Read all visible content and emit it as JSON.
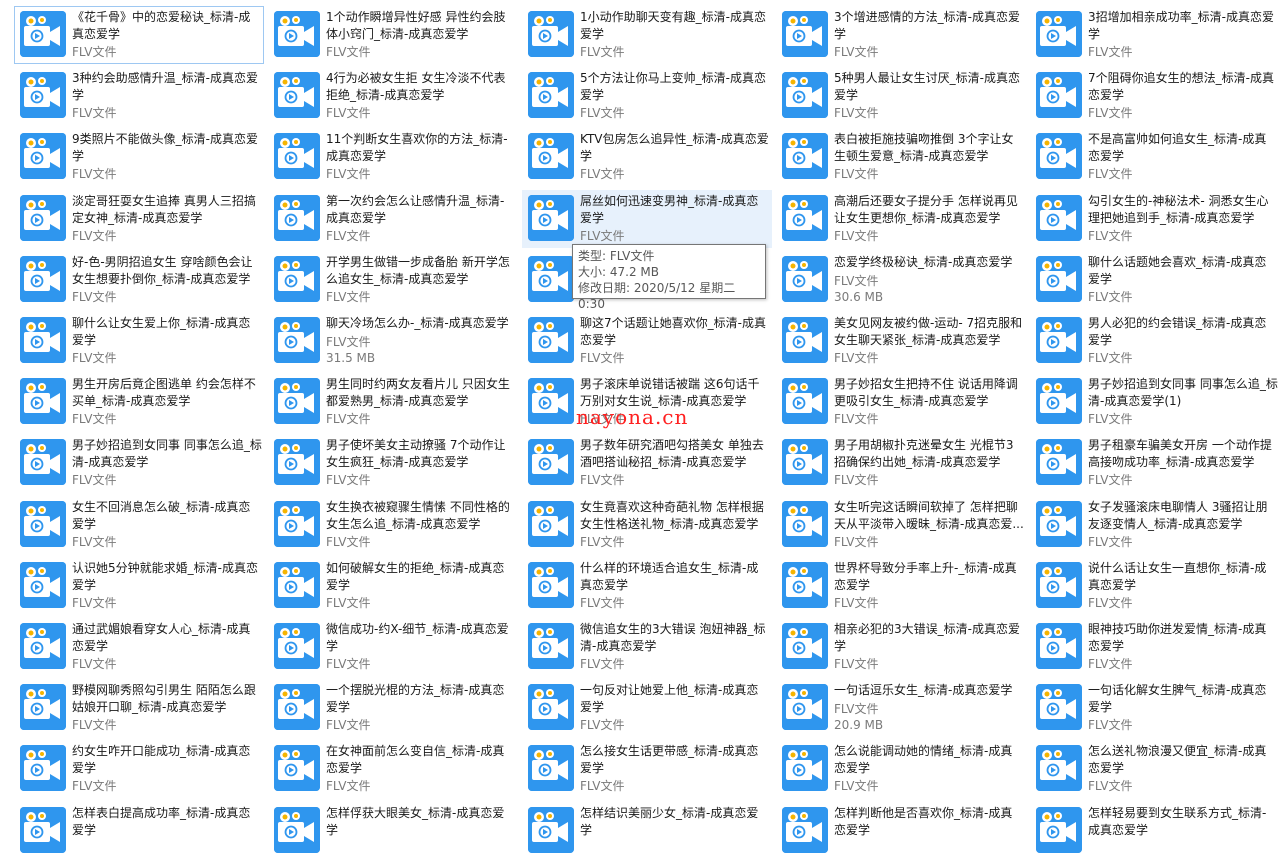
{
  "file_type_label": "FLV文件",
  "icon_name": "video-file-icon",
  "files": [
    {
      "name": "《花千骨》中的恋爱秘诀_标清-成真恋爱学",
      "sub": "FLV文件"
    },
    {
      "name": "1个动作瞬增异性好感 异性约会肢体小窍门_标清-成真恋爱学",
      "sub": "FLV文件"
    },
    {
      "name": "1小动作助聊天变有趣_标清-成真恋爱学",
      "sub": "FLV文件"
    },
    {
      "name": "3个增进感情的方法_标清-成真恋爱学",
      "sub": "FLV文件"
    },
    {
      "name": "3招增加相亲成功率_标清-成真恋爱学",
      "sub": "FLV文件"
    },
    {
      "name": "3种约会助感情升温_标清-成真恋爱学",
      "sub": "FLV文件"
    },
    {
      "name": "4行为必被女生拒 女生冷淡不代表拒绝_标清-成真恋爱学",
      "sub": "FLV文件"
    },
    {
      "name": "5个方法让你马上变帅_标清-成真恋爱学",
      "sub": "FLV文件"
    },
    {
      "name": "5种男人最让女生讨厌_标清-成真恋爱学",
      "sub": "FLV文件"
    },
    {
      "name": "7个阻碍你追女生的想法_标清-成真恋爱学",
      "sub": "FLV文件"
    },
    {
      "name": "9类照片不能做头像_标清-成真恋爱学",
      "sub": "FLV文件"
    },
    {
      "name": "11个判断女生喜欢你的方法_标清-成真恋爱学",
      "sub": "FLV文件"
    },
    {
      "name": "KTV包房怎么追异性_标清-成真恋爱学",
      "sub": "FLV文件"
    },
    {
      "name": "表白被拒施技骗吻推倒 3个字让女生顿生爱意_标清-成真恋爱学",
      "sub": "FLV文件"
    },
    {
      "name": "不是高富帅如何追女生_标清-成真恋爱学",
      "sub": "FLV文件"
    },
    {
      "name": "淡定哥狂耍女生追捧 真男人三招搞定女神_标清-成真恋爱学",
      "sub": "FLV文件"
    },
    {
      "name": "第一次约会怎么让感情升温_标清-成真恋爱学",
      "sub": "FLV文件"
    },
    {
      "name": "屌丝如何迅速变男神_标清-成真恋爱学",
      "sub": "FLV文件"
    },
    {
      "name": "高潮后还要女子提分手 怎样说再见让女生更想你_标清-成真恋爱学",
      "sub": "FLV文件"
    },
    {
      "name": "勾引女生的-神秘法术- 洞悉女生心理把她追到手_标清-成真恋爱学",
      "sub": "FLV文件"
    },
    {
      "name": "好-色-男阴招追女生 穿啥颜色会让女生想要扑倒你_标清-成真恋爱学",
      "sub": "FLV文件"
    },
    {
      "name": "开学男生做错一步成备胎 新开学怎么追女生_标清-成真恋爱学",
      "sub": "FLV文件"
    },
    {
      "name": "",
      "sub": ""
    },
    {
      "name": "恋爱学终极秘诀_标清-成真恋爱学",
      "sub": "FLV文件",
      "size": "30.6 MB"
    },
    {
      "name": "聊什么话题她会喜欢_标清-成真恋爱学",
      "sub": "FLV文件"
    },
    {
      "name": "聊什么让女生爱上你_标清-成真恋爱学",
      "sub": "FLV文件"
    },
    {
      "name": "聊天冷场怎么办-_标清-成真恋爱学",
      "sub": "FLV文件",
      "size": "31.5 MB"
    },
    {
      "name": "聊这7个话题让她喜欢你_标清-成真恋爱学",
      "sub": "FLV文件"
    },
    {
      "name": "美女见网友被约做-运动- 7招克服和女生聊天紧张_标清-成真恋爱学",
      "sub": "FLV文件"
    },
    {
      "name": "男人必犯的约会错误_标清-成真恋爱学",
      "sub": "FLV文件"
    },
    {
      "name": "男生开房后竟企图逃单 约会怎样不买单_标清-成真恋爱学",
      "sub": "FLV文件"
    },
    {
      "name": "男生同时约两女友看片儿 只因女生都爱熟男_标清-成真恋爱学",
      "sub": "FLV文件"
    },
    {
      "name": "男子滚床单说错话被踹 这6句话千万别对女生说_标清-成真恋爱学",
      "sub": "FLV文件"
    },
    {
      "name": "男子妙招女生把持不住 说话用降调更吸引女生_标清-成真恋爱学",
      "sub": "FLV文件"
    },
    {
      "name": "男子妙招追到女同事 同事怎么追_标清-成真恋爱学(1)",
      "sub": "FLV文件"
    },
    {
      "name": "男子妙招追到女同事 同事怎么追_标清-成真恋爱学",
      "sub": "FLV文件"
    },
    {
      "name": "男子使坏美女主动撩骚 7个动作让女生疯狂_标清-成真恋爱学",
      "sub": "FLV文件"
    },
    {
      "name": "男子数年研究酒吧勾搭美女 单独去酒吧搭讪秘招_标清-成真恋爱学",
      "sub": "FLV文件"
    },
    {
      "name": "男子用胡椒扑克迷晕女生 光棍节3招确保约出她_标清-成真恋爱学",
      "sub": "FLV文件"
    },
    {
      "name": "男子租豪车骗美女开房 一个动作提高接吻成功率_标清-成真恋爱学",
      "sub": "FLV文件"
    },
    {
      "name": "女生不回消息怎么破_标清-成真恋爱学",
      "sub": "FLV文件"
    },
    {
      "name": "女生换衣被窥骤生情愫 不同性格的女生怎么追_标清-成真恋爱学",
      "sub": "FLV文件"
    },
    {
      "name": "女生竟喜欢这种奇葩礼物 怎样根据女生性格送礼物_标清-成真恋爱学",
      "sub": "FLV文件"
    },
    {
      "name": "女生听完这话瞬间软掉了 怎样把聊天从平淡带入暧昧_标清-成真恋爱...",
      "sub": "FLV文件"
    },
    {
      "name": "女子发骚滚床电聊情人 3骚招让朋友逐变情人_标清-成真恋爱学",
      "sub": "FLV文件"
    },
    {
      "name": "认识她5分钟就能求婚_标清-成真恋爱学",
      "sub": "FLV文件"
    },
    {
      "name": "如何破解女生的拒绝_标清-成真恋爱学",
      "sub": "FLV文件"
    },
    {
      "name": "什么样的环境适合追女生_标清-成真恋爱学",
      "sub": "FLV文件"
    },
    {
      "name": "世界杯导致分手率上升-_标清-成真恋爱学",
      "sub": "FLV文件"
    },
    {
      "name": "说什么话让女生一直想你_标清-成真恋爱学",
      "sub": "FLV文件"
    },
    {
      "name": "通过武媚娘看穿女人心_标清-成真恋爱学",
      "sub": "FLV文件"
    },
    {
      "name": "微信成功-约X-细节_标清-成真恋爱学",
      "sub": "FLV文件"
    },
    {
      "name": "微信追女生的3大错误 泡妞神器_标清-成真恋爱学",
      "sub": "FLV文件"
    },
    {
      "name": "相亲必犯的3大错误_标清-成真恋爱学",
      "sub": "FLV文件"
    },
    {
      "name": "眼神技巧助你迸发爱情_标清-成真恋爱学",
      "sub": "FLV文件"
    },
    {
      "name": "野模网聊秀照勾引男生 陌陌怎么跟姑娘开口聊_标清-成真恋爱学",
      "sub": "FLV文件"
    },
    {
      "name": "一个摆脱光棍的方法_标清-成真恋爱学",
      "sub": "FLV文件"
    },
    {
      "name": "一句反对让她爱上他_标清-成真恋爱学",
      "sub": "FLV文件"
    },
    {
      "name": "一句话逗乐女生_标清-成真恋爱学",
      "sub": "FLV文件",
      "size": "20.9 MB"
    },
    {
      "name": "一句话化解女生脾气_标清-成真恋爱学",
      "sub": "FLV文件"
    },
    {
      "name": "约女生咋开口能成功_标清-成真恋爱学",
      "sub": "FLV文件"
    },
    {
      "name": "在女神面前怎么变自信_标清-成真恋爱学",
      "sub": "FLV文件"
    },
    {
      "name": "怎么接女生话更带感_标清-成真恋爱学",
      "sub": "FLV文件"
    },
    {
      "name": "怎么说能调动她的情绪_标清-成真恋爱学",
      "sub": "FLV文件"
    },
    {
      "name": "怎么送礼物浪漫又便宜_标清-成真恋爱学",
      "sub": "FLV文件"
    },
    {
      "name": "怎样表白提高成功率_标清-成真恋爱学",
      "sub": ""
    },
    {
      "name": "怎样俘获大眼美女_标清-成真恋爱学",
      "sub": ""
    },
    {
      "name": "怎样结识美丽少女_标清-成真恋爱学",
      "sub": ""
    },
    {
      "name": "怎样判断他是否喜欢你_标清-成真恋爱学",
      "sub": ""
    },
    {
      "name": "怎样轻易要到女生联系方式_标清-成真恋爱学",
      "sub": ""
    }
  ],
  "tooltip": {
    "type_line": "类型: FLV文件",
    "size_line": "大小: 47.2 MB",
    "date_line": "修改日期: 2020/5/12 星期二 0:30"
  },
  "watermark": "nayona.cn"
}
